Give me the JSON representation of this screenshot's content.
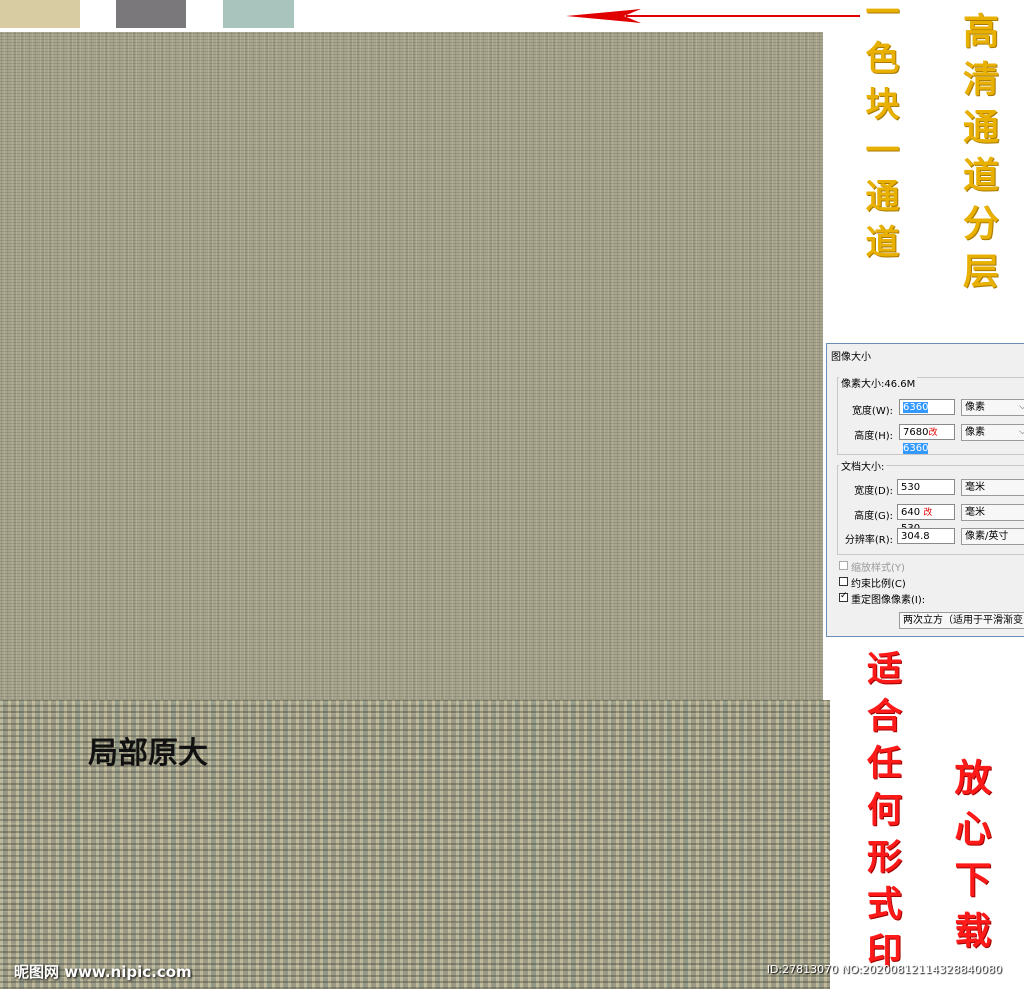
{
  "swatches": [
    {
      "color": "#d8cda2"
    },
    {
      "color": "#7a787a"
    },
    {
      "color": "#a9c3bd"
    }
  ],
  "colors": {
    "arrow": "#e00000",
    "gold": "#e8b000",
    "red": "#ff1a1a"
  },
  "detail_label": "局部原大",
  "gold_texts": [
    "一色块一通道",
    "高清通道分层"
  ],
  "red_texts": [
    "适合任何形式印",
    "放心下载"
  ],
  "dialog": {
    "title": "图像大小",
    "pixel_group": {
      "label": "像素大小:46.6M",
      "width_label": "宽度(W):",
      "width_value": "6360",
      "width_unit": "像素",
      "height_label": "高度(H):",
      "height_old": "7680",
      "height_mark": "改",
      "height_value": "6360",
      "height_unit": "像素"
    },
    "doc_group": {
      "label": "文档大小:",
      "width_label": "宽度(D):",
      "width_value": "530",
      "width_unit": "毫米",
      "height_label": "高度(G):",
      "height_old": "640",
      "height_mark": "改",
      "height_value": "530",
      "height_unit": "毫米",
      "res_label": "分辨率(R):",
      "res_value": "304.8",
      "res_unit": "像素/英寸"
    },
    "scale_styles_label": "缩放样式(Y)",
    "constrain_label": "约束比例(C)",
    "resample_label": "重定图像像素(I):",
    "resample_method": "两次立方（适用于平滑渐变"
  },
  "watermark_left": "昵图网 www.nipic.com",
  "watermark_right": "ID:27813070 NO:20200812114328840080"
}
